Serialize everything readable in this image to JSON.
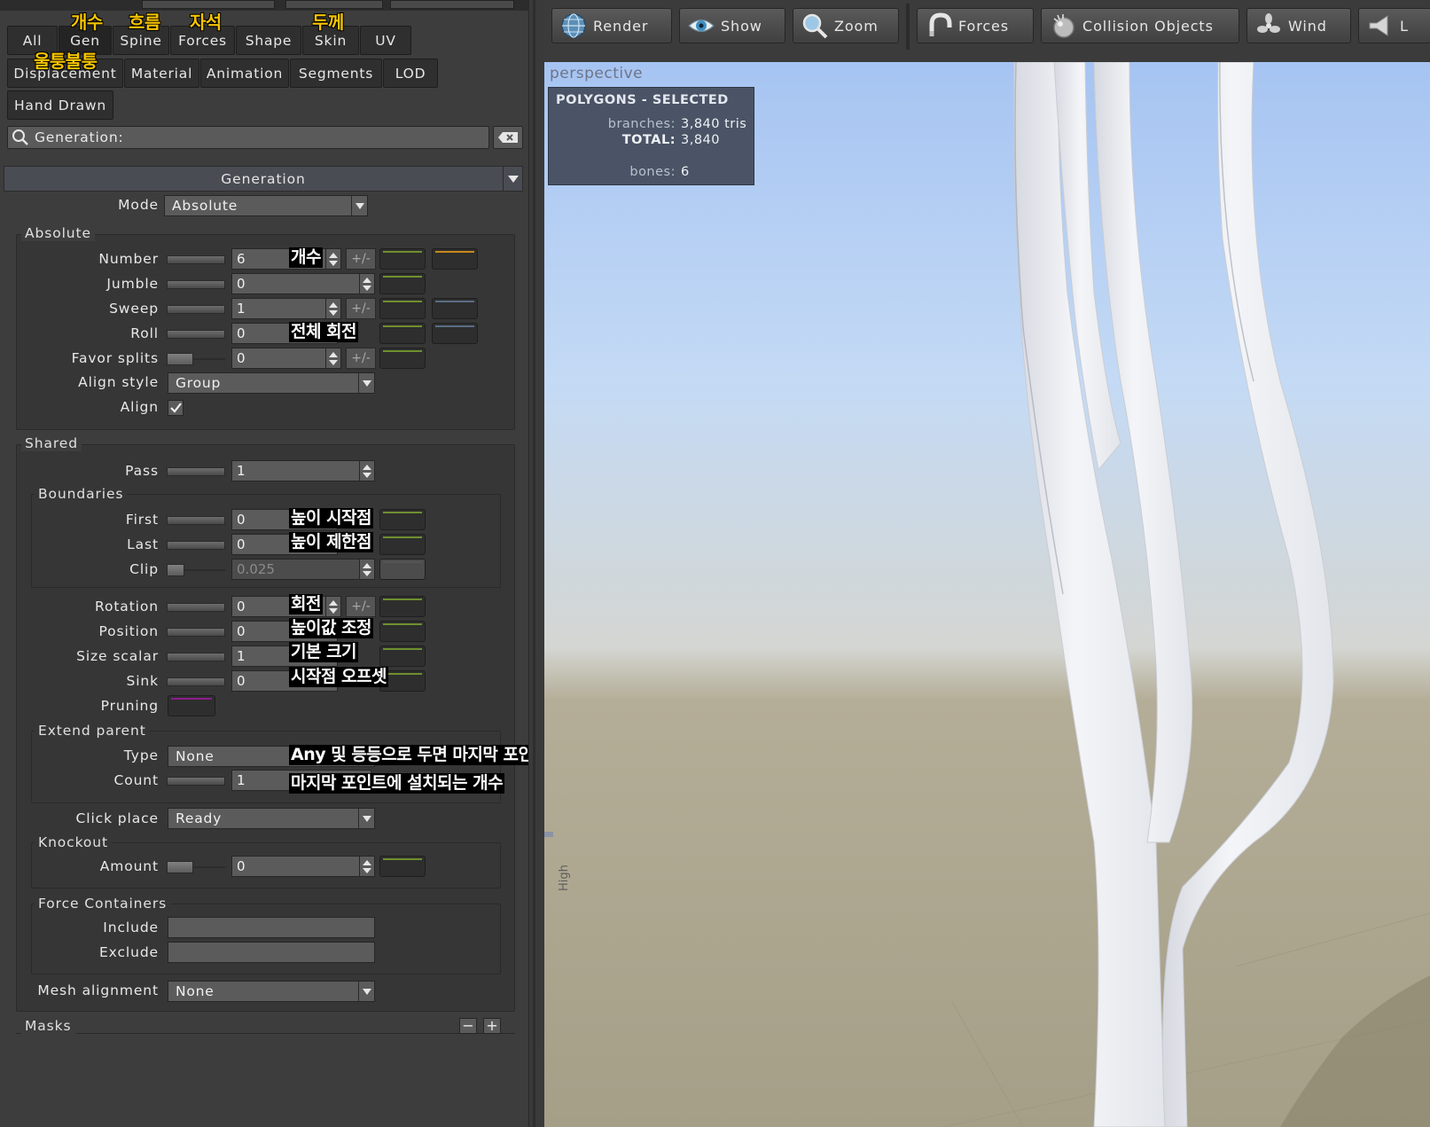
{
  "tabs_row1": [
    "All",
    "Gen",
    "Spine",
    "Forces",
    "Shape",
    "Skin",
    "UV"
  ],
  "tabs_row2": [
    "Displacement",
    "Material",
    "Animation",
    "Segments",
    "LOD"
  ],
  "tabs_row3": [
    "Hand Drawn"
  ],
  "tab_annotations": {
    "gen": "개수",
    "spine": "흐름",
    "forces": "자석",
    "skin": "두께",
    "displacement": "울퉁불퉁"
  },
  "search": {
    "value": "Generation:"
  },
  "section_title": "Generation",
  "mode": {
    "label": "Mode",
    "value": "Absolute"
  },
  "absolute": {
    "title": "Absolute",
    "number": {
      "label": "Number",
      "value": "6",
      "note": "개수"
    },
    "jumble": {
      "label": "Jumble",
      "value": "0"
    },
    "sweep": {
      "label": "Sweep",
      "value": "1"
    },
    "roll": {
      "label": "Roll",
      "value": "0",
      "note": "전체 회전"
    },
    "favor_splits": {
      "label": "Favor splits",
      "value": "0"
    },
    "align_style": {
      "label": "Align style",
      "value": "Group"
    },
    "align": {
      "label": "Align",
      "checked": true
    }
  },
  "plusminus": "+/-",
  "shared": {
    "title": "Shared",
    "pass": {
      "label": "Pass",
      "value": "1"
    },
    "boundaries": {
      "title": "Boundaries",
      "first": {
        "label": "First",
        "value": "0",
        "note": "높이 시작점"
      },
      "last": {
        "label": "Last",
        "value": "0",
        "note": "높이 제한점"
      },
      "clip": {
        "label": "Clip",
        "value": "0.025"
      }
    },
    "rotation": {
      "label": "Rotation",
      "value": "0",
      "note": "회전"
    },
    "position": {
      "label": "Position",
      "value": "0",
      "note": "높이값 조정"
    },
    "size_scalar": {
      "label": "Size scalar",
      "value": "1",
      "note": "기본 크기"
    },
    "sink": {
      "label": "Sink",
      "value": "0",
      "note": "시작점 오프셋"
    },
    "pruning": {
      "label": "Pruning"
    },
    "extend_parent": {
      "title": "Extend parent",
      "type": {
        "label": "Type",
        "value": "None",
        "note": "Any 및 등등으로 두면 마지막 포인트에서 시작"
      },
      "count": {
        "label": "Count",
        "value": "1",
        "note": "마지막 포인트에 설치되는 개수"
      }
    },
    "click_place": {
      "label": "Click place",
      "value": "Ready"
    },
    "knockout": {
      "title": "Knockout",
      "amount": {
        "label": "Amount",
        "value": "0"
      }
    },
    "force_containers": {
      "title": "Force Containers",
      "include": {
        "label": "Include"
      },
      "exclude": {
        "label": "Exclude"
      }
    },
    "mesh_alignment": {
      "label": "Mesh alignment",
      "value": "None"
    }
  },
  "masks": {
    "title": "Masks",
    "minus": "−",
    "plus": "+"
  },
  "toolbar": {
    "buttons": [
      "Render",
      "Show",
      "Zoom",
      "Forces",
      "Collision Objects",
      "Wind",
      "L"
    ]
  },
  "viewport": {
    "label": "perspective",
    "stats": {
      "title": "POLYGONS - SELECTED",
      "branches_label": "branches:",
      "branches_value": "3,840 tris",
      "total_label": "TOTAL:",
      "total_value": "3,840",
      "bones_label": "bones:",
      "bones_value": "6"
    },
    "high_label": "High"
  },
  "colors": {
    "curve_green": "#6f8f2f",
    "curve_orange": "#c88a1a",
    "curve_blue": "#5b6e86",
    "pruning_purple": "#8a1d8a",
    "annotation_yellow": "#f6c400"
  }
}
